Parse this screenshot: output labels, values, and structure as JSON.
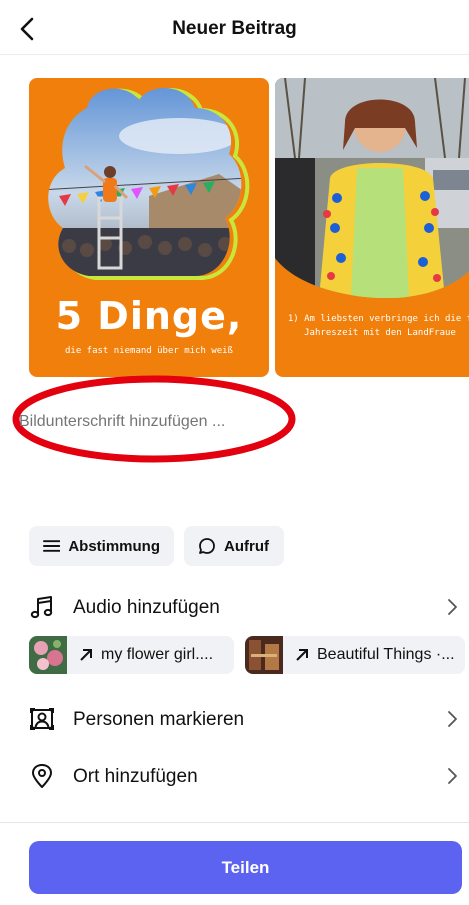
{
  "header": {
    "title": "Neuer Beitrag",
    "back_icon": "chevron-left-icon"
  },
  "slides": [
    {
      "title": "5 Dinge,",
      "subtitle": "die fast niemand über mich weiß"
    },
    {
      "text_line1": "1) Am liebsten verbringe ich die f",
      "text_line2": "Jahreszeit mit den LandFraue"
    }
  ],
  "caption": {
    "placeholder": "Bildunterschrift hinzufügen ...",
    "highlight_color": "#e3000f"
  },
  "chips": {
    "poll_label": "Abstimmung",
    "call_label": "Aufruf"
  },
  "rows": {
    "audio_label": "Audio hinzufügen",
    "people_label": "Personen markieren",
    "place_label": "Ort hinzufügen"
  },
  "songs": [
    {
      "label": "my flower girl...."
    },
    {
      "label": "Beautiful Things ·..."
    }
  ],
  "share": {
    "label": "Teilen"
  },
  "colors": {
    "accent": "#5b63f0",
    "slide_bg": "#f17f0c",
    "chip_bg": "#f1f2f5"
  }
}
